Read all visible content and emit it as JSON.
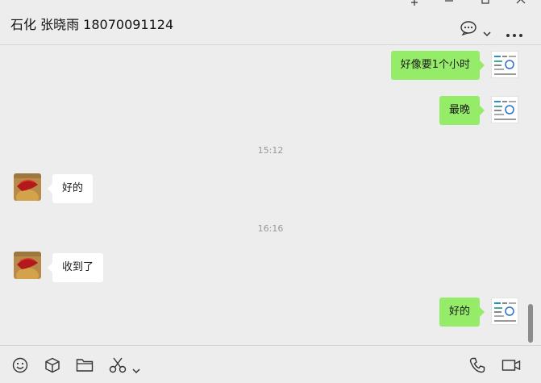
{
  "header": {
    "title": "石化 张晓雨 18070091124",
    "icons": [
      "pin-icon",
      "minimize-icon",
      "maximize-icon",
      "close-icon",
      "chat-options-icon",
      "chevron-down-icon",
      "more-icon"
    ]
  },
  "messages": [
    {
      "from": "me",
      "text": "好像要1个小时"
    },
    {
      "from": "me",
      "text": "最晚"
    },
    {
      "type": "time",
      "text": "15:12"
    },
    {
      "from": "them",
      "text": "好的"
    },
    {
      "type": "time",
      "text": "16:16"
    },
    {
      "from": "them",
      "text": "收到了"
    },
    {
      "from": "me",
      "text": "好的"
    }
  ],
  "toolbar": {
    "icons": [
      "emoji-icon",
      "box-icon",
      "folder-icon",
      "scissors-icon",
      "chevron-down-icon",
      "phone-icon",
      "video-icon"
    ]
  },
  "colors": {
    "my_bubble": "#95ec69",
    "their_bubble": "#ffffff",
    "background": "#ededed"
  }
}
